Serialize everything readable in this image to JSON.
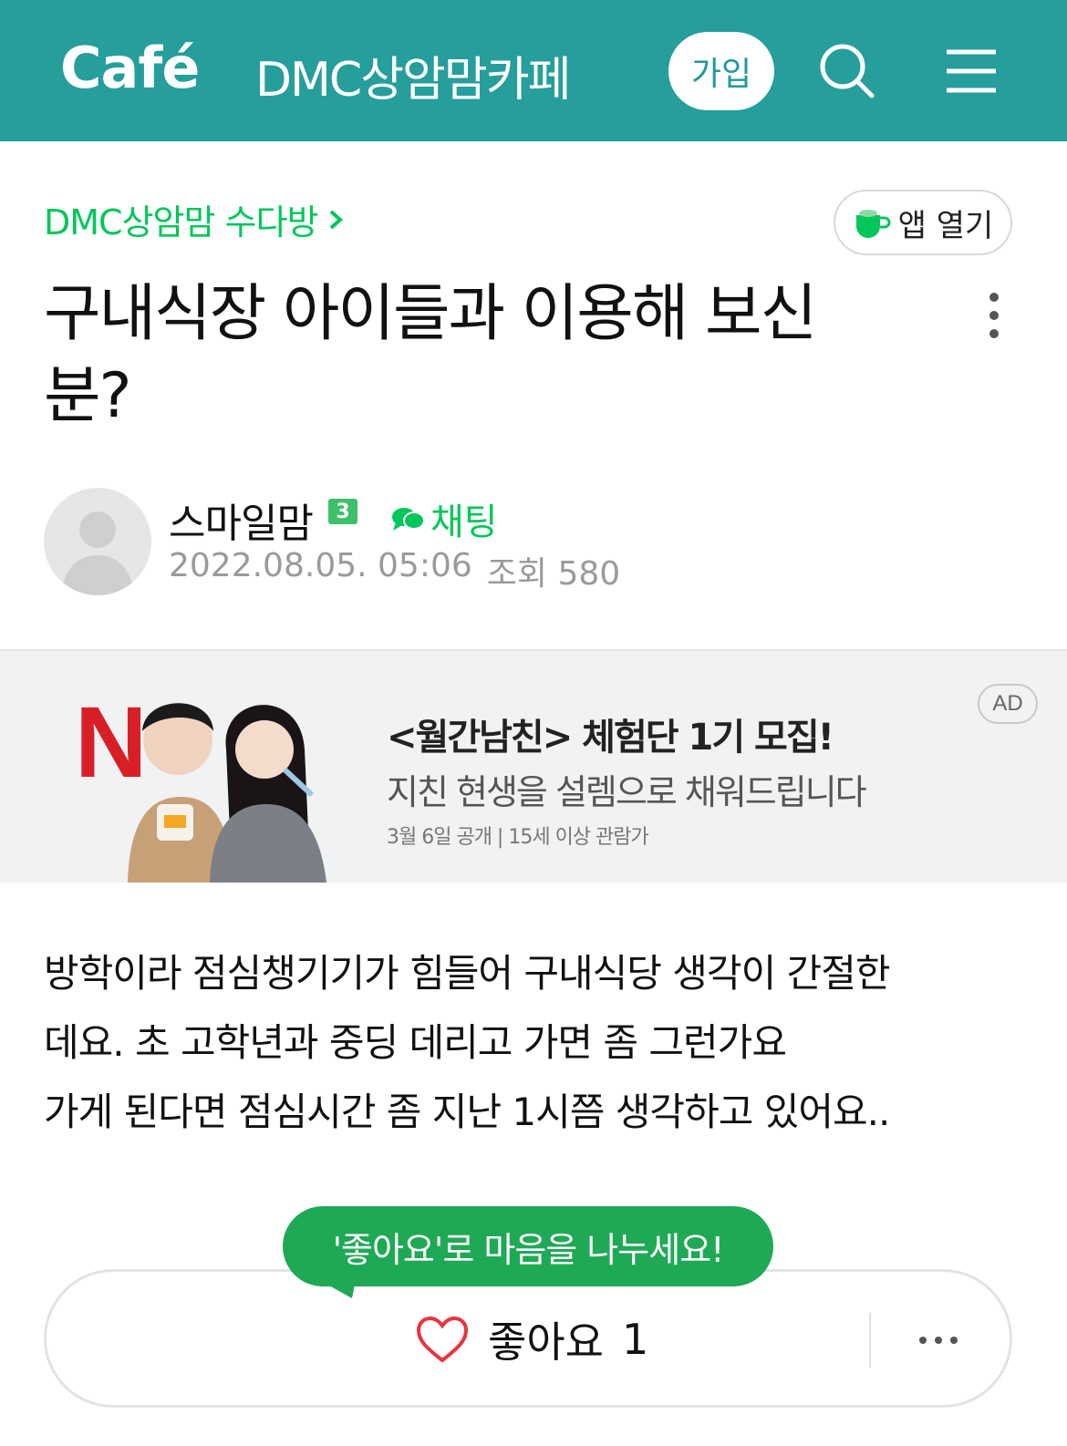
{
  "header": {
    "logo": "Café",
    "cafe_name": "DMC상암맘카페",
    "join_label": "가입",
    "icons": [
      "search-icon",
      "menu-icon"
    ]
  },
  "board": {
    "name": "DMC상암맘 수다방",
    "app_open_label": "앱 열기"
  },
  "post": {
    "title": "구내식장 아이들과 이용해 보신 분?",
    "author": "스마일맘",
    "level": "3",
    "chat_label": "채팅",
    "date": "2022.08.05. 05:06",
    "views": "조회 580",
    "body_lines": [
      "방학이라 점심챙기기가 힘들어 구내식당 생각이 간절한",
      "데요.  초 고학년과 중딩 데리고 가면 좀 그런가요",
      "가게 된다면 점심시간 좀 지난 1시쯤 생각하고 있어요.."
    ]
  },
  "ad": {
    "title": "<월간남친> 체험단 1기 모집!",
    "subtitle": "지친 현생을 설렘으로 채워드립니다",
    "note": "3월 6일 공개 | 15세 이상 관람가",
    "badge": "AD",
    "brand_letter": "N"
  },
  "like": {
    "tooltip": "'좋아요'로 마음을 나누세요!",
    "label": "좋아요",
    "count": "1"
  },
  "colors": {
    "header_bg": "#259e9c",
    "accent_green": "#03c75a",
    "tooltip_bg": "#1fa955"
  }
}
